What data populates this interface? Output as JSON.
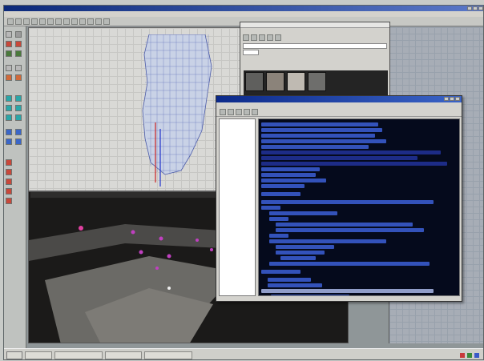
{
  "editor": {
    "title": "",
    "menu": [
      "",
      "",
      "",
      "",
      "",
      "",
      "",
      ""
    ],
    "viewport_caption": ""
  },
  "texture_browser": {
    "title": "",
    "menu": [
      "",
      "",
      ""
    ],
    "filter_value": "",
    "thumbnail_colors": [
      "#5f5f5d",
      "#8b837a",
      "#bfbab2",
      "#6e6e6c"
    ]
  },
  "script_editor": {
    "title": "",
    "menu": [
      "",
      ""
    ],
    "status": ""
  },
  "taskbar": {
    "start_label": "",
    "tasks": [
      "",
      "",
      "",
      ""
    ],
    "clock": ""
  },
  "colors": {
    "titlebar": "#0c2a8a",
    "code_bg": "#050a1c",
    "code_text": "#3c5fd6"
  }
}
